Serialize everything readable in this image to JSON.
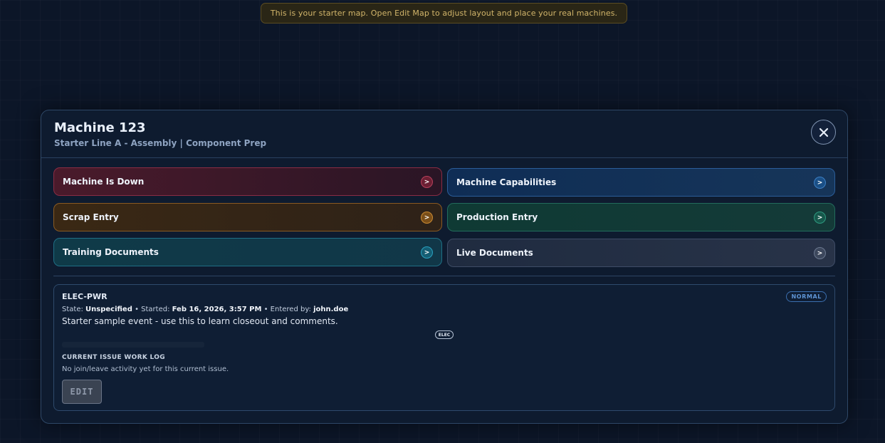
{
  "banner": {
    "text": "This is your starter map. Open Edit Map to adjust layout and place your real machines."
  },
  "modal": {
    "title": "Machine 123",
    "subtitle": "Starter Line A - Assembly | Component Prep",
    "close_icon": "close-icon"
  },
  "actions": [
    {
      "label": "Machine Is Down",
      "chevron": ">"
    },
    {
      "label": "Machine Capabilities",
      "chevron": ">"
    },
    {
      "label": "Scrap Entry",
      "chevron": ">"
    },
    {
      "label": "Production Entry",
      "chevron": ">"
    },
    {
      "label": "Training Documents",
      "chevron": ">"
    },
    {
      "label": "Live Documents",
      "chevron": ">"
    }
  ],
  "event": {
    "code": "ELEC-PWR",
    "badge": "NORMAL",
    "state_label": "State:",
    "state": "Unspecified",
    "started_label": "• Started:",
    "started": "Feb 16, 2026, 3:57 PM",
    "entered_label": "• Entered by:",
    "entered_by": "john.doe",
    "description": "Starter sample event - use this to learn closeout and comments.",
    "tag": "ELEC",
    "log_title": "CURRENT ISSUE WORK LOG",
    "log_text": "No join/leave activity yet for this current issue.",
    "edit_label": "EDIT"
  },
  "colors": {
    "background": "#0c1628",
    "down": "#8a2c44",
    "capabilities": "#2b5d99",
    "scrap": "#8a5a22",
    "production": "#226b5c",
    "training": "#1f6f85",
    "live": "#3e4c66"
  }
}
